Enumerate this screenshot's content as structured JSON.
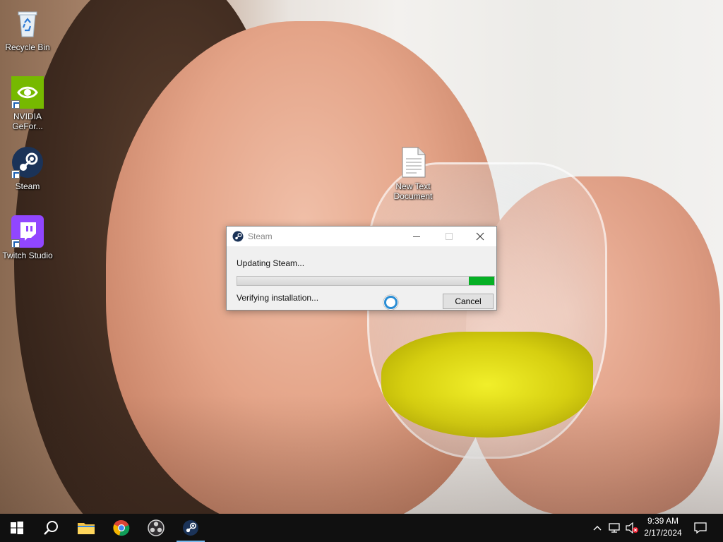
{
  "desktop": {
    "icons": [
      {
        "label": "Recycle Bin",
        "icon": "recycle-bin-icon"
      },
      {
        "label": "NVIDIA GeFor...",
        "icon": "nvidia-icon"
      },
      {
        "label": "Steam",
        "icon": "steam-icon"
      },
      {
        "label": "Twitch Studio",
        "icon": "twitch-icon"
      },
      {
        "label": "New Text Document",
        "icon": "text-document-icon"
      }
    ]
  },
  "dialog": {
    "title": "Steam",
    "status": "Updating Steam...",
    "sub_status": "Verifying installation...",
    "cancel_label": "Cancel",
    "progress_fraction": 0.1,
    "progress_color": "#06b025"
  },
  "taskbar": {
    "pinned": [
      {
        "name": "start-button",
        "icon": "windows-logo-icon"
      },
      {
        "name": "search-button",
        "icon": "search-icon"
      },
      {
        "name": "file-explorer-button",
        "icon": "folder-icon"
      },
      {
        "name": "chrome-button",
        "icon": "chrome-icon"
      },
      {
        "name": "obs-button",
        "icon": "obs-icon"
      },
      {
        "name": "steam-taskbar-button",
        "icon": "steam-icon",
        "active": true
      }
    ],
    "tray": {
      "time": "9:39 AM",
      "date": "2/17/2024"
    }
  }
}
